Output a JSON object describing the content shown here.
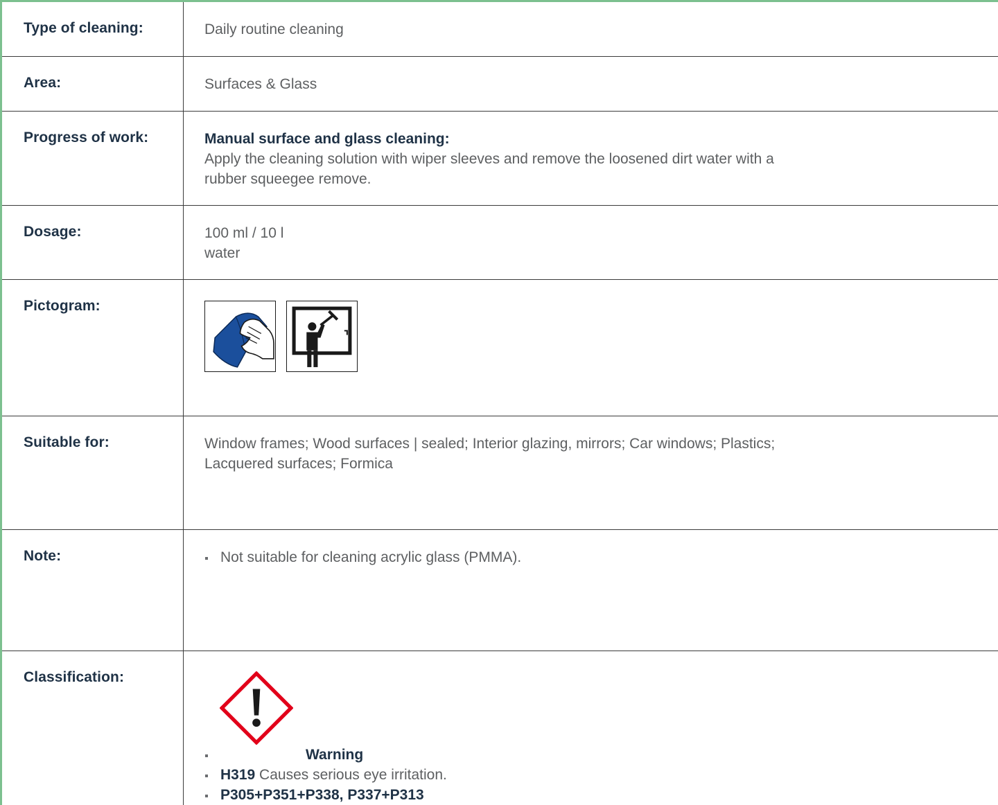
{
  "rows": {
    "type": {
      "label": "Type of cleaning:",
      "value": "Daily routine cleaning"
    },
    "area": {
      "label": "Area:",
      "value": "Surfaces & Glass"
    },
    "progress": {
      "label": "Progress of work:",
      "heading": "Manual surface and glass cleaning:",
      "line1": "Apply the cleaning solution with wiper sleeves and remove the loosened dirt water with a",
      "line2": "rubber squeegee remove."
    },
    "dosage": {
      "label": "Dosage:",
      "line1": "100 ml / 10 l",
      "line2": "water"
    },
    "pictogram": {
      "label": "Pictogram:",
      "icons": [
        "wiping-cloth-hand-icon",
        "window-squeegee-person-icon"
      ]
    },
    "suitable": {
      "label": "Suitable for:",
      "line1": "Window frames; Wood surfaces | sealed; Interior glazing, mirrors; Car windows; Plastics;",
      "line2": "Lacquered surfaces; Formica"
    },
    "note": {
      "label": "Note:",
      "items": [
        "Not suitable for cleaning acrylic glass (PMMA)."
      ]
    },
    "classification": {
      "label": "Classification:",
      "hazard_icon": "ghs-exclamation-mark-icon",
      "signal_word": "Warning",
      "h_code": "H319",
      "h_text": "Causes serious eye irritation.",
      "p_codes": "P305+P351+P338, P337+P313"
    }
  },
  "colors": {
    "accent": "#7cc08f",
    "label": "#1f3246",
    "hazard_red": "#e2001a",
    "cloth_blue": "#1b4f9c"
  }
}
